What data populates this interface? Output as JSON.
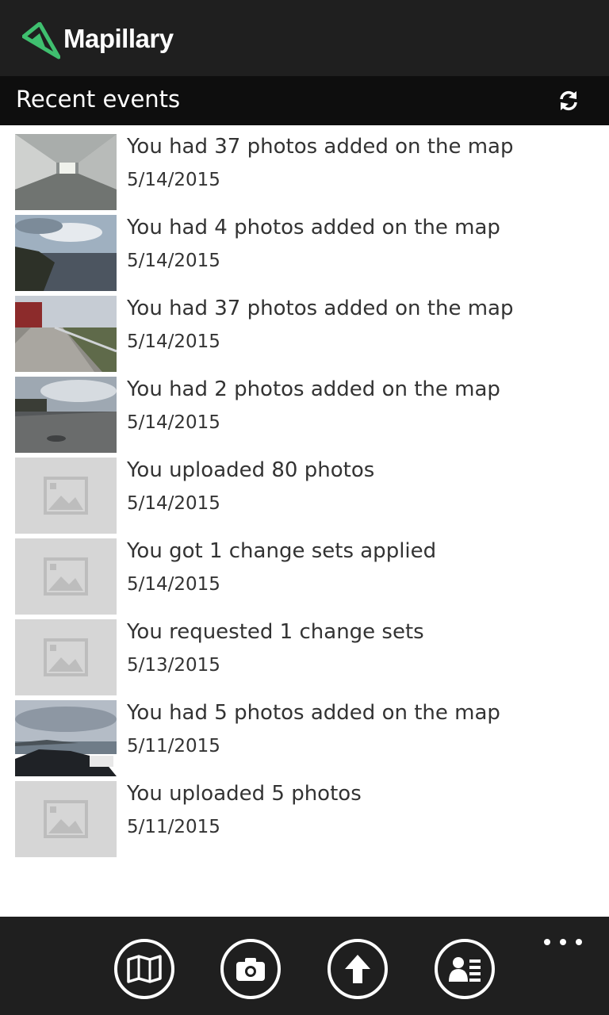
{
  "header": {
    "app_name": "Mapillary",
    "brand_color": "#3fbf6f"
  },
  "section": {
    "title": "Recent events",
    "refresh_icon": "refresh-icon"
  },
  "events": [
    {
      "text": "You had 37 photos added on the map",
      "date": "5/14/2015",
      "thumbnail": "tunnel-photo"
    },
    {
      "text": "You had 4 photos added on the map",
      "date": "5/14/2015",
      "thumbnail": "coast-photo"
    },
    {
      "text": "You had 37 photos added on the map",
      "date": "5/14/2015",
      "thumbnail": "road-photo"
    },
    {
      "text": "You had 2 photos added on the map",
      "date": "5/14/2015",
      "thumbnail": "street-photo"
    },
    {
      "text": "You uploaded 80 photos",
      "date": "5/14/2015",
      "thumbnail": "placeholder"
    },
    {
      "text": "You got 1 change sets applied",
      "date": "5/14/2015",
      "thumbnail": "placeholder"
    },
    {
      "text": "You requested 1 change sets",
      "date": "5/13/2015",
      "thumbnail": "placeholder"
    },
    {
      "text": "You had 5 photos added on the map",
      "date": "5/11/2015",
      "thumbnail": "fjord-photo"
    },
    {
      "text": "You uploaded 5 photos",
      "date": "5/11/2015",
      "thumbnail": "placeholder"
    }
  ],
  "app_bar": {
    "buttons": [
      "map-icon",
      "camera-icon",
      "upload-icon",
      "profile-icon"
    ],
    "more_icon": "more-icon"
  }
}
